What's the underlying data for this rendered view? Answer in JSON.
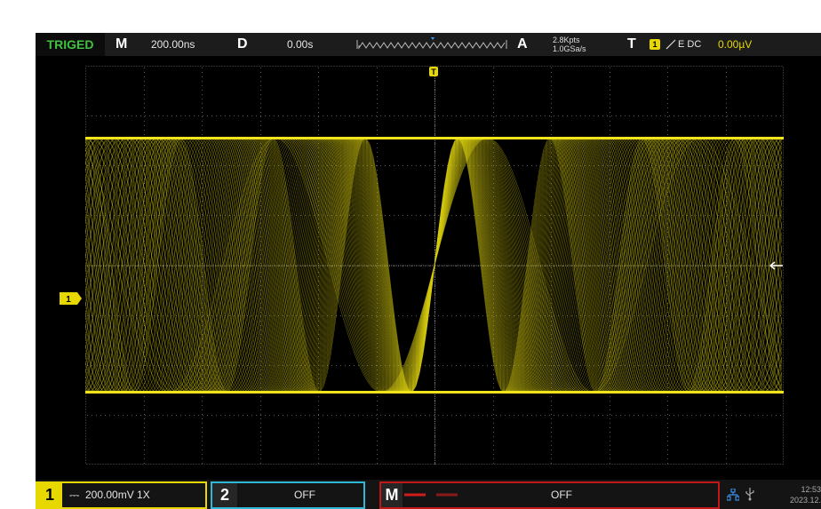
{
  "top": {
    "status": "TRIGED",
    "m_label": "M",
    "timebase": "200.00ns",
    "d_label": "D",
    "delay": "0.00s",
    "a_label": "A",
    "memory_depth": "2.8Kpts",
    "sample_rate": "1.0GSa/s",
    "t_label": "T",
    "trigger_source": "1",
    "trigger_mode": "E DC",
    "trigger_level": "0.00µV"
  },
  "plot": {
    "trigger_marker": "T",
    "ch1_marker": "1"
  },
  "bottom": {
    "ch1": {
      "num": "1",
      "coupling_glyph": "⎓",
      "scale": "200.00mV 1X"
    },
    "ch2": {
      "num": "2",
      "state": "OFF"
    },
    "math": {
      "num": "M",
      "state": "OFF"
    },
    "time": "12:53",
    "date": "2023.12."
  },
  "colors": {
    "ch1": "#e6d800",
    "ch2": "#2fb7d6",
    "math": "#c01818",
    "triged": "#3fc23f"
  }
}
